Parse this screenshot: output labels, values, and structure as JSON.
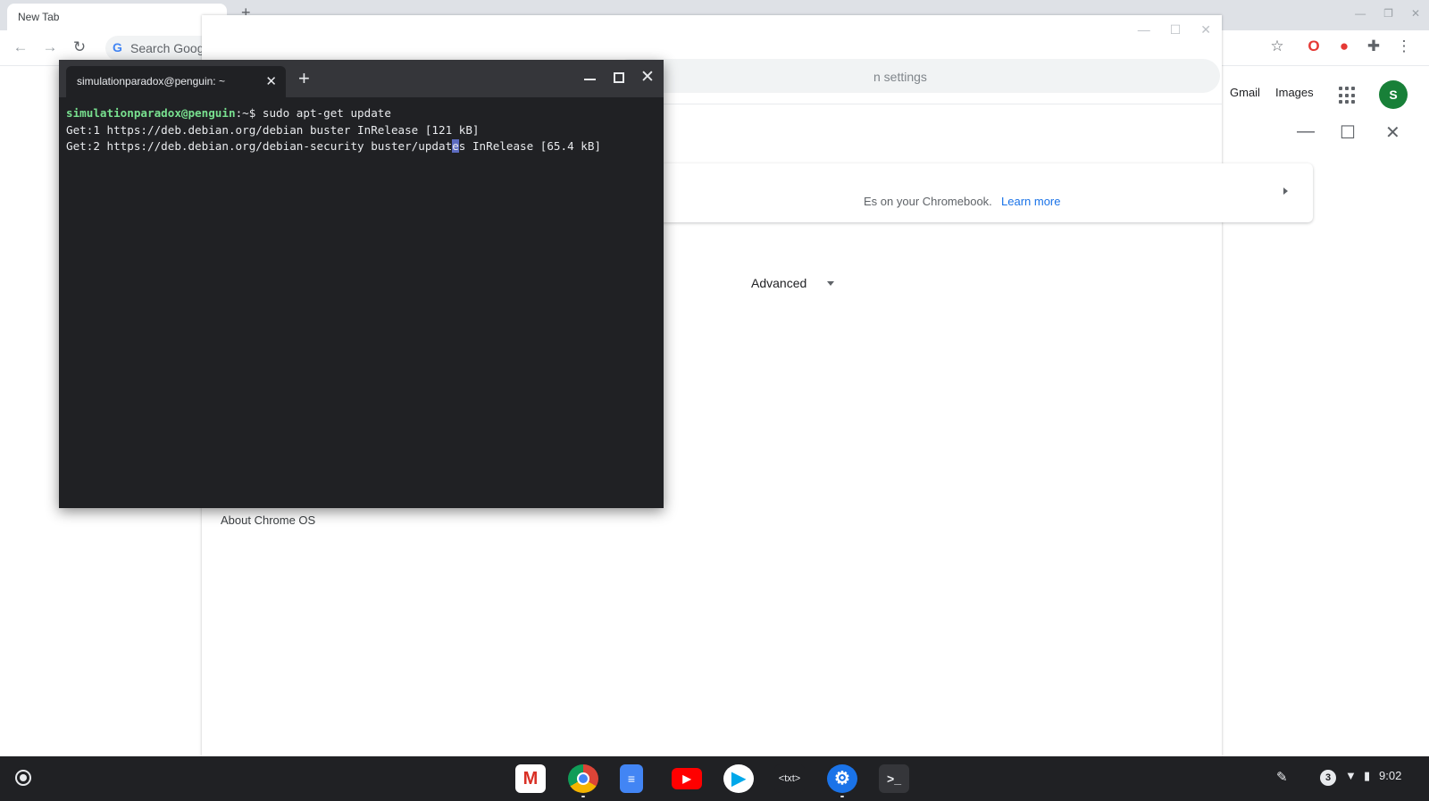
{
  "browser": {
    "tab_title": "New Tab",
    "omnibox_placeholder": "Search Goog",
    "google_links": {
      "gmail": "Gmail",
      "images": "Images"
    },
    "avatar_letter": "S"
  },
  "settings": {
    "search_placeholder": "n settings",
    "card_text": "Es on your Chromebook.",
    "card_link": "Learn more",
    "advanced_label": "Advanced",
    "about_label": "About Chrome OS"
  },
  "terminal": {
    "tab_title": "simulationparadox@penguin: ~",
    "prompt_user": "simulationparadox@penguin",
    "prompt_path": ":~$",
    "command": " sudo apt-get update",
    "line1": "Get:1 https://deb.debian.org/debian buster InRelease [121 kB]",
    "line2_before_cursor": "Get:2 https://deb.debian.org/debian-security buster/updat",
    "line2_cursor_char": "e",
    "line2_after_cursor": "s InRelease [65.4 kB]"
  },
  "shelf": {
    "apps": [
      "gmail",
      "chrome",
      "docs",
      "youtube",
      "play-store",
      "text",
      "settings",
      "terminal"
    ],
    "text_app_label": "<txt>",
    "terminal_app_label": ">_",
    "notification_count": "3",
    "time": "9:02"
  },
  "colors": {
    "terminal_bg": "#202124",
    "prompt_green": "#78e08f",
    "link_blue": "#1a73e8",
    "shelf_bg": "#202124"
  }
}
